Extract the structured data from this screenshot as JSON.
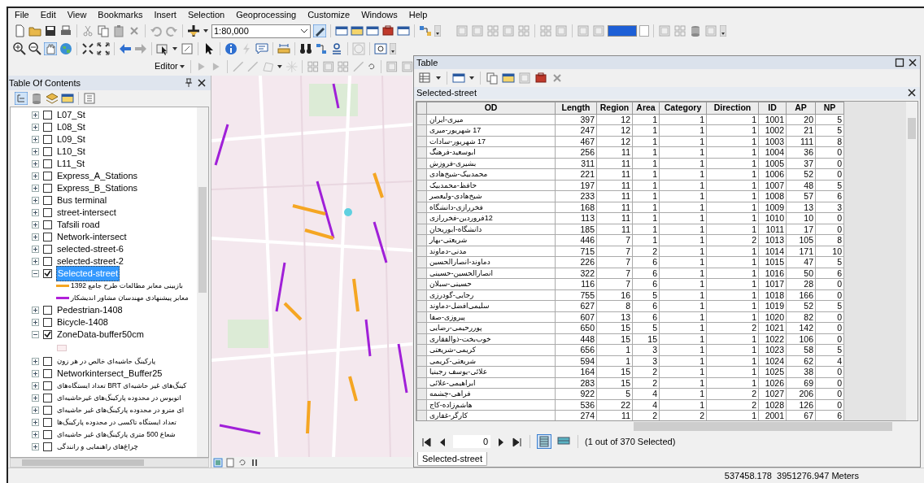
{
  "menu_bar": [
    "File",
    "Edit",
    "View",
    "Bookmarks",
    "Insert",
    "Selection",
    "Geoprocessing",
    "Customize",
    "Windows",
    "Help"
  ],
  "toolbar": {
    "scale": "1:80,000",
    "editor_label": "Editor"
  },
  "toc": {
    "title": "Table Of Contents",
    "items": [
      {
        "kind": "layer",
        "label": "L07_St",
        "checked": false,
        "expanded": false,
        "selected": false
      },
      {
        "kind": "layer",
        "label": "L08_St",
        "checked": false,
        "expanded": false,
        "selected": false
      },
      {
        "kind": "layer",
        "label": "L09_St",
        "checked": false,
        "expanded": false,
        "selected": false
      },
      {
        "kind": "layer",
        "label": "L10_St",
        "checked": false,
        "expanded": false,
        "selected": false
      },
      {
        "kind": "layer",
        "label": "L11_St",
        "checked": false,
        "expanded": false,
        "selected": false
      },
      {
        "kind": "layer",
        "label": "Express_A_Stations",
        "checked": false,
        "expanded": false,
        "selected": false
      },
      {
        "kind": "layer",
        "label": "Express_B_Stations",
        "checked": false,
        "expanded": false,
        "selected": false
      },
      {
        "kind": "layer",
        "label": "Bus terminal",
        "checked": false,
        "expanded": false,
        "selected": false
      },
      {
        "kind": "layer",
        "label": "street-intersect",
        "checked": false,
        "expanded": false,
        "selected": false
      },
      {
        "kind": "layer",
        "label": "Tafsili road",
        "checked": false,
        "expanded": false,
        "selected": false
      },
      {
        "kind": "layer",
        "label": "Network-intersect",
        "checked": false,
        "expanded": false,
        "selected": false
      },
      {
        "kind": "layer",
        "label": "selected-street-6",
        "checked": false,
        "expanded": false,
        "selected": false
      },
      {
        "kind": "layer",
        "label": "selected-street-2",
        "checked": false,
        "expanded": false,
        "selected": false
      },
      {
        "kind": "layer",
        "label": "Selected-street",
        "checked": true,
        "expanded": true,
        "selected": true,
        "children": [
          {
            "kind": "legend",
            "label": "بازبینی معابر مطالعات طرح جامع 1392",
            "color": "#f5a623"
          },
          {
            "kind": "legend",
            "label": "معابر پیشنهادی مهندسان مشاور اندیشکار",
            "color": "#b020d8"
          }
        ]
      },
      {
        "kind": "layer",
        "label": "Pedestrian-1408",
        "checked": false,
        "expanded": false,
        "selected": false
      },
      {
        "kind": "layer",
        "label": "Bicycle-1408",
        "checked": false,
        "expanded": false,
        "selected": false
      },
      {
        "kind": "layer",
        "label": "ZoneData-buffer50cm",
        "checked": true,
        "expanded": true,
        "selected": false,
        "children": [
          {
            "kind": "swatch",
            "color": "#fbeef0"
          }
        ]
      },
      {
        "kind": "layer",
        "label": "پارکینگ حاشیه‌ای خالص در هر زون",
        "checked": false,
        "expanded": false,
        "selected": false
      },
      {
        "kind": "layer",
        "label": "Networkintersect_Buffer25",
        "checked": false,
        "expanded": false,
        "selected": false
      },
      {
        "kind": "layer",
        "label": "کینگ‌های غیر حاشیه‌ای BRT تعداد ایستگاه‌های",
        "checked": false,
        "expanded": false,
        "selected": false
      },
      {
        "kind": "layer",
        "label": "اتوبوس در محدوده پارکینگ‌های غیرحاشیه‌ای",
        "checked": false,
        "expanded": false,
        "selected": false
      },
      {
        "kind": "layer",
        "label": "ای مترو در محدوده پارکینگ‌های غیر حاشیه‌ای",
        "checked": false,
        "expanded": false,
        "selected": false
      },
      {
        "kind": "layer",
        "label": "تعداد ایستگاه تاکسی در محدوده پارکینگ‌ها",
        "checked": false,
        "expanded": false,
        "selected": false
      },
      {
        "kind": "layer",
        "label": "شعاع 500 متری پارکینگ‌های غیر حاشیه‌ای",
        "checked": false,
        "expanded": false,
        "selected": false
      },
      {
        "kind": "layer",
        "label": "چراغ‌های راهنمایی و رانندگی",
        "checked": false,
        "expanded": false,
        "selected": false
      }
    ]
  },
  "table_window": {
    "title": "Table",
    "table_name": "Selected-street",
    "columns": [
      "OD",
      "Length",
      "Region",
      "Area",
      "Category",
      "Direction",
      "ID",
      "AP",
      "NP"
    ],
    "rows": [
      [
        "میری-ایران",
        "397",
        "12",
        "1",
        "1",
        "1",
        "1001",
        "20",
        "5"
      ],
      [
        "17 شهریور-میری",
        "247",
        "12",
        "1",
        "1",
        "1",
        "1002",
        "21",
        "5"
      ],
      [
        "17 شهریور-سادات",
        "467",
        "12",
        "1",
        "1",
        "1",
        "1003",
        "111",
        "8"
      ],
      [
        "ابوسعید-فرهنگ",
        "256",
        "11",
        "1",
        "1",
        "1",
        "1004",
        "36",
        "0"
      ],
      [
        "بشیری-فروزش",
        "311",
        "11",
        "1",
        "1",
        "1",
        "1005",
        "37",
        "0"
      ],
      [
        "محمدبیک-شیخ‌هادی",
        "221",
        "11",
        "1",
        "1",
        "1",
        "1006",
        "52",
        "0"
      ],
      [
        "حافظ-محمدبیک",
        "197",
        "11",
        "1",
        "1",
        "1",
        "1007",
        "48",
        "5"
      ],
      [
        "شیخ‌هادی-ولیعصر",
        "233",
        "11",
        "1",
        "1",
        "1",
        "1008",
        "57",
        "6"
      ],
      [
        "فخررازی-دانشگاه",
        "168",
        "11",
        "1",
        "1",
        "1",
        "1009",
        "13",
        "3"
      ],
      [
        "12فروردین-فخررازی",
        "113",
        "11",
        "1",
        "1",
        "1",
        "1010",
        "10",
        "0"
      ],
      [
        "دانشگاه-ابوریحان",
        "185",
        "11",
        "1",
        "1",
        "1",
        "1011",
        "17",
        "0"
      ],
      [
        "شریعتی-بهار",
        "446",
        "7",
        "1",
        "1",
        "2",
        "1013",
        "105",
        "8"
      ],
      [
        "مدنی-دماوند",
        "715",
        "7",
        "2",
        "1",
        "1",
        "1014",
        "171",
        "10"
      ],
      [
        "دماوند-انصارالحسین",
        "226",
        "7",
        "6",
        "1",
        "1",
        "1015",
        "47",
        "5"
      ],
      [
        "انصارالحسین-حسینی",
        "322",
        "7",
        "6",
        "1",
        "1",
        "1016",
        "50",
        "6"
      ],
      [
        "حسینی-سبلان",
        "116",
        "7",
        "6",
        "1",
        "1",
        "1017",
        "28",
        "0"
      ],
      [
        "رجایی-گودرزی",
        "755",
        "16",
        "5",
        "1",
        "1",
        "1018",
        "166",
        "0"
      ],
      [
        "سلیمی‌افضل-دماوند",
        "627",
        "8",
        "6",
        "1",
        "1",
        "1019",
        "52",
        "5"
      ],
      [
        "پیروزی-صفا",
        "607",
        "13",
        "6",
        "1",
        "1",
        "1020",
        "82",
        "0"
      ],
      [
        "پوررحیمی-رضایی",
        "650",
        "15",
        "5",
        "1",
        "2",
        "1021",
        "142",
        "0"
      ],
      [
        "خوب‌بخت-ذوالفقاری",
        "448",
        "15",
        "15",
        "1",
        "1",
        "1022",
        "106",
        "0"
      ],
      [
        "کریمی-شریعتی",
        "656",
        "1",
        "3",
        "1",
        "1",
        "1023",
        "58",
        "5"
      ],
      [
        "شریعتی-کریمی",
        "594",
        "1",
        "3",
        "1",
        "1",
        "1024",
        "62",
        "4"
      ],
      [
        "علائی-یوسف رجبنیا",
        "164",
        "15",
        "2",
        "1",
        "1",
        "1025",
        "38",
        "0"
      ],
      [
        "ابراهیمی-علائی",
        "283",
        "15",
        "2",
        "1",
        "1",
        "1026",
        "69",
        "0"
      ],
      [
        "فراهی-چشمه",
        "922",
        "5",
        "4",
        "1",
        "2",
        "1027",
        "206",
        "0"
      ],
      [
        "هاشم‌زاده-کاج",
        "536",
        "22",
        "4",
        "1",
        "2",
        "1028",
        "126",
        "0"
      ],
      [
        "کارگر-غفاری",
        "274",
        "11",
        "2",
        "2",
        "1",
        "2001",
        "67",
        "6"
      ]
    ],
    "record": "0",
    "selection_info": "(1 out of 370 Selected)",
    "tabs": [
      {
        "label": "Selected-street",
        "selected": true
      }
    ]
  },
  "status_bar": {
    "coordinates": "537458.178  3951276.947 Meters"
  }
}
